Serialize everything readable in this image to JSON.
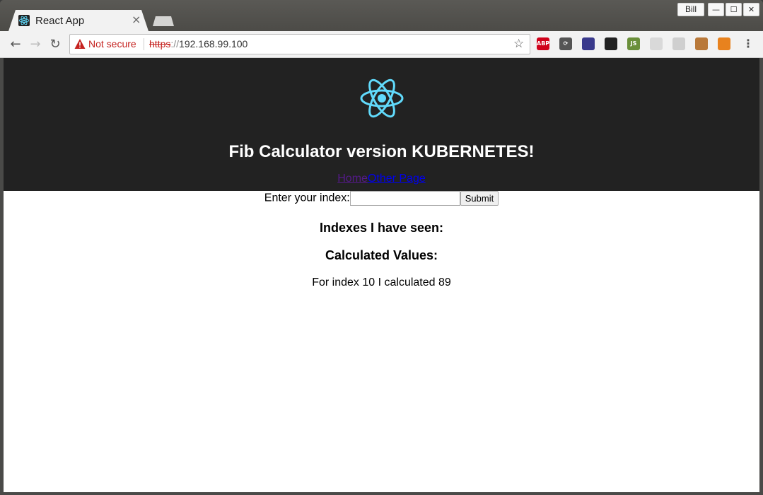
{
  "browser": {
    "tab_title": "React App",
    "tab_close": "×",
    "user_name": "Bill",
    "window_controls": {
      "minimize": "—",
      "maximize": "☐",
      "close": "✕"
    },
    "nav": {
      "back": "←",
      "forward": "→",
      "reload": "↻"
    },
    "security_label": "Not secure",
    "url_scheme": "https",
    "url_sep": "://",
    "url_host": "192.168.99.100",
    "bookmark_star": "☆",
    "extensions": [
      {
        "name": "adblock-plus-icon",
        "label": "ABP",
        "color": "#d0021b"
      },
      {
        "name": "sync-icon",
        "label": "⟳",
        "color": "#555555"
      },
      {
        "name": "color-picker-icon",
        "label": "",
        "color": "#3a3a8c"
      },
      {
        "name": "react-devtools-icon",
        "label": "",
        "color": "#222222"
      },
      {
        "name": "js-icon",
        "label": "JS",
        "color": "#6a8f3a"
      },
      {
        "name": "ghost-icon",
        "label": "",
        "color": "#d9d9d9"
      },
      {
        "name": "shield-extension-icon",
        "label": "",
        "color": "#cfcfcf"
      },
      {
        "name": "monkey-icon",
        "label": "",
        "color": "#b9793a"
      },
      {
        "name": "fox-icon",
        "label": "",
        "color": "#e8821e"
      }
    ],
    "menu": "⋮"
  },
  "page": {
    "title": "Fib Calculator version KUBERNETES!",
    "nav_links": {
      "home": "Home",
      "other": "Other Page"
    },
    "form": {
      "label": "Enter your index:",
      "input_value": "",
      "submit": "Submit"
    },
    "indexes_heading": "Indexes I have seen:",
    "values_heading": "Calculated Values:",
    "calculated": "For index 10 I calculated 89"
  },
  "colors": {
    "header_bg": "#222222",
    "react_blue": "#61dafb",
    "not_secure_red": "#c5221f"
  }
}
